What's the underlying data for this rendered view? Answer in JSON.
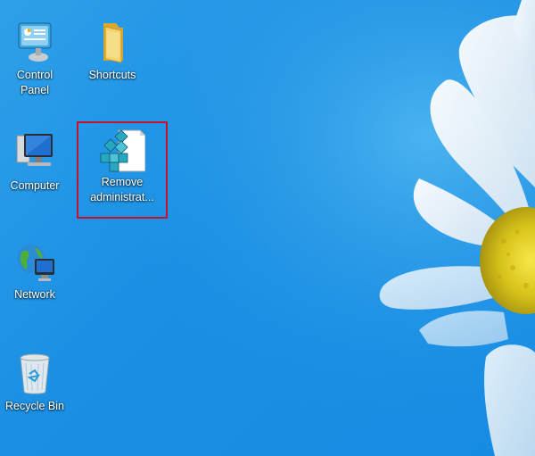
{
  "desktop": {
    "icons": [
      {
        "label": "Control\nPanel",
        "icon": "control-panel-icon"
      },
      {
        "label": "Shortcuts",
        "icon": "folder-icon"
      },
      {
        "label": "Computer",
        "icon": "computer-icon"
      },
      {
        "label": "Remove\nadministrat...",
        "icon": "registry-file-icon"
      },
      {
        "label": "Network",
        "icon": "network-icon"
      },
      {
        "label": "Recycle Bin",
        "icon": "recycle-bin-icon"
      }
    ],
    "highlight_color": "#c8102e",
    "background_color": "#1b8fe3"
  }
}
